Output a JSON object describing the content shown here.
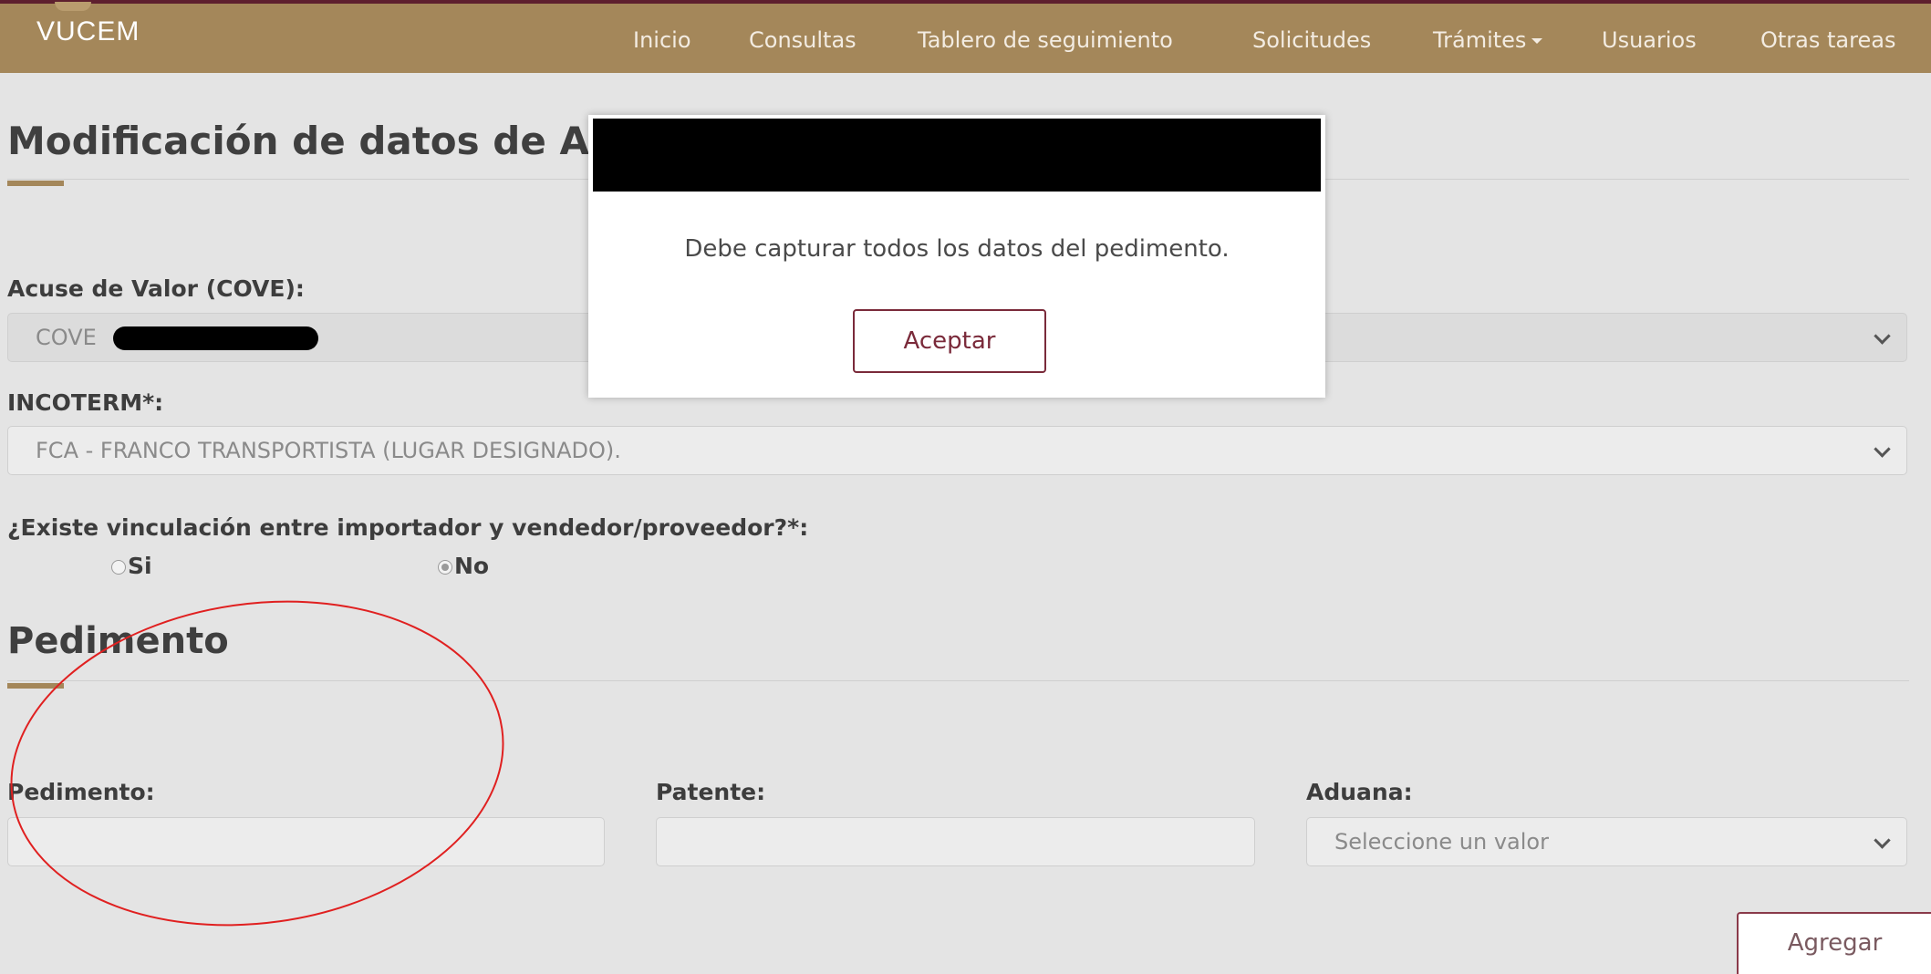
{
  "app": {
    "brand": "VUCEM"
  },
  "nav": {
    "items": [
      {
        "label": "Inicio"
      },
      {
        "label": "Consultas"
      },
      {
        "label": "Tablero de seguimiento"
      },
      {
        "label": "Solicitudes"
      },
      {
        "label": "Trámites"
      },
      {
        "label": "Usuarios"
      },
      {
        "label": "Otras tareas"
      }
    ]
  },
  "page": {
    "title": "Modificación de datos de Ac"
  },
  "form": {
    "cove": {
      "label": "Acuse de Valor (COVE):",
      "value": "COVE"
    },
    "incoterm": {
      "label": "INCOTERM*:",
      "value": "FCA - FRANCO TRANSPORTISTA (LUGAR DESIGNADO)."
    },
    "vinculacion": {
      "label": "¿Existe vinculación entre importador y vendedor/proveedor?*:",
      "options": [
        {
          "label": "Si",
          "checked": false
        },
        {
          "label": "No",
          "checked": true
        }
      ]
    }
  },
  "pedimento_section": {
    "title": "Pedimento",
    "pedimento_label": "Pedimento:",
    "patente_label": "Patente:",
    "aduana_label": "Aduana:",
    "aduana_placeholder": "Seleccione un valor",
    "add_button": "Agregar"
  },
  "modal": {
    "message": "Debe capturar todos los datos del pedimento.",
    "accept_button": "Aceptar"
  },
  "colors": {
    "navbar": "#a4875a",
    "accent_border": "#5e1f2e",
    "button_text": "#7a2a3a",
    "annotation": "#e02020"
  }
}
